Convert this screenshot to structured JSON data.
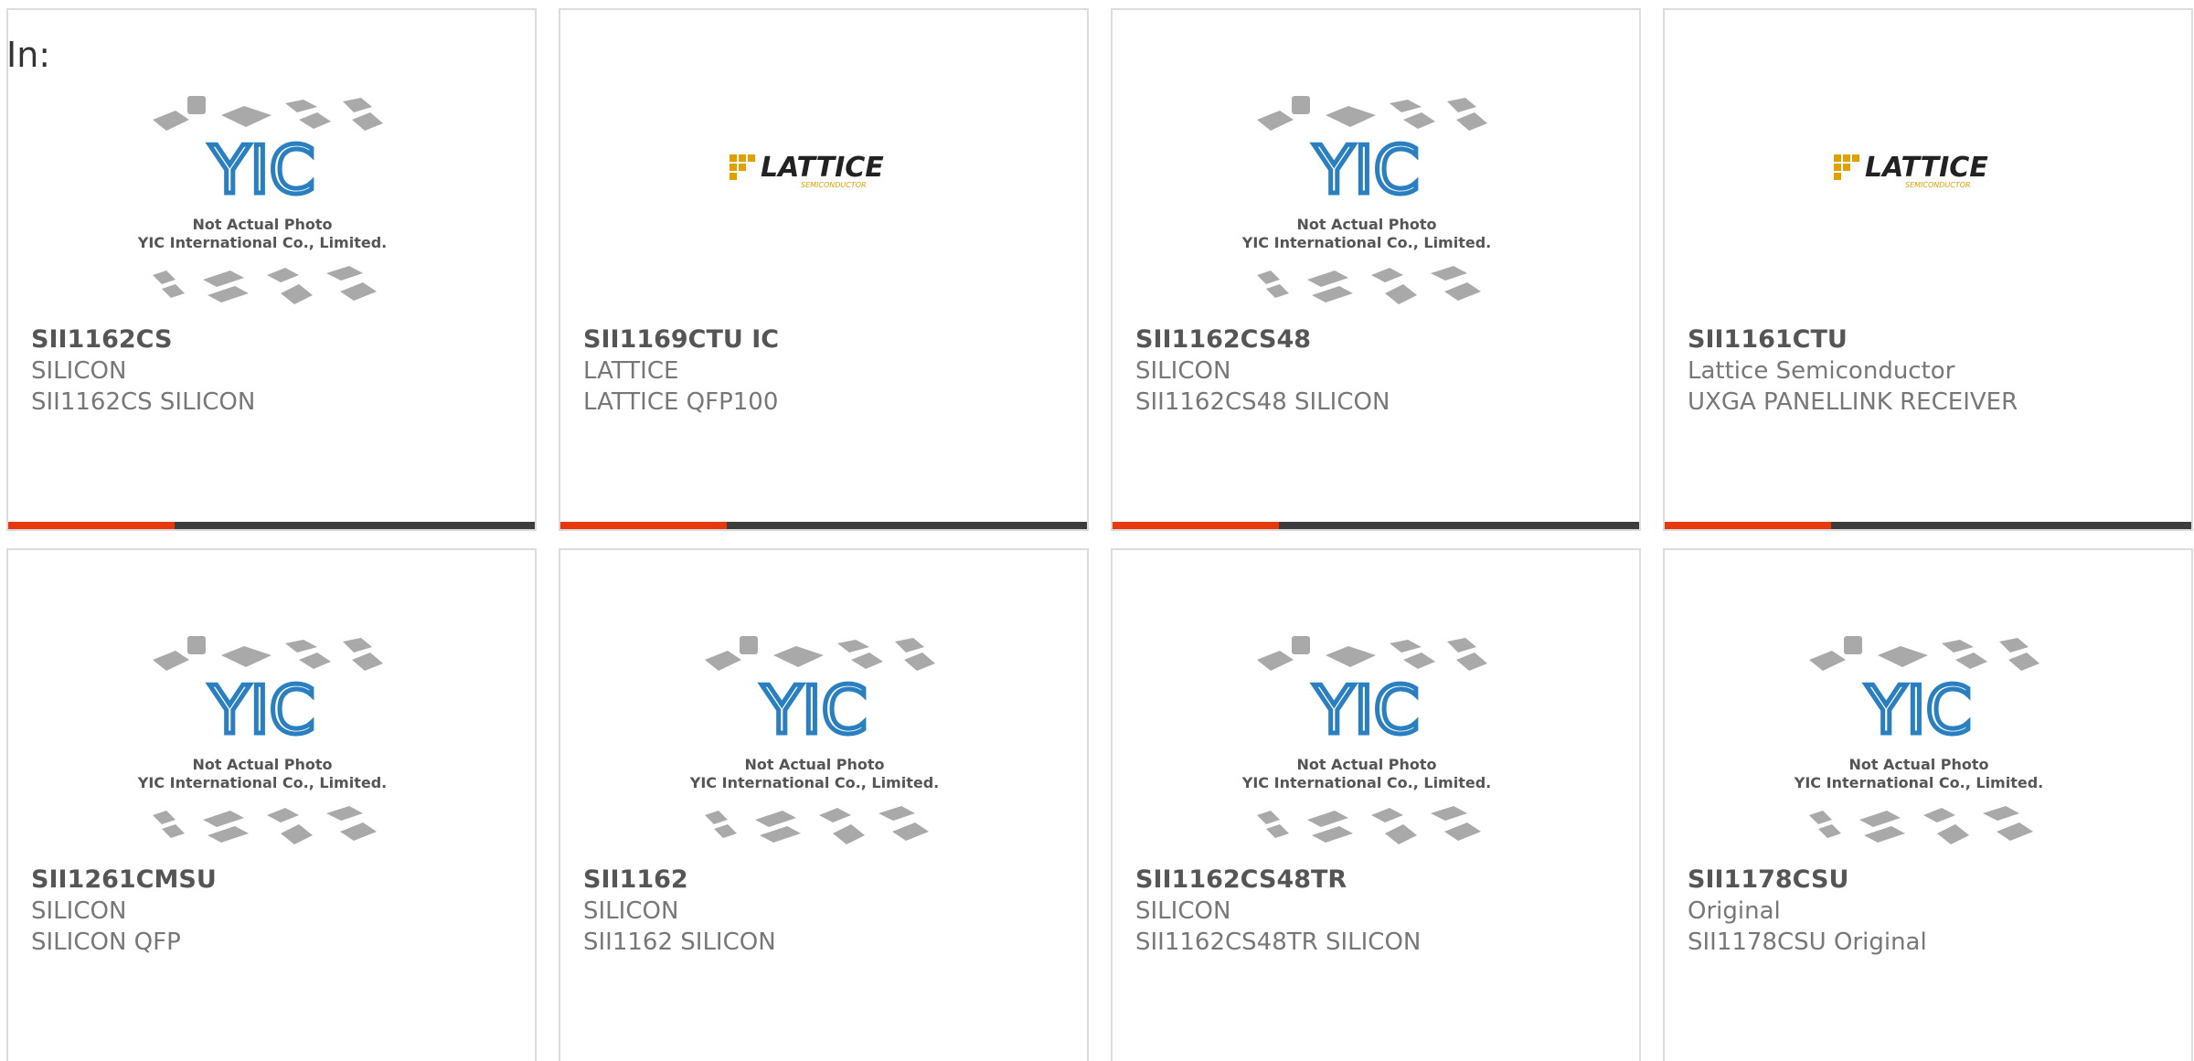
{
  "header": {
    "label": "In:"
  },
  "placeholder": {
    "line1": "Not Actual Photo",
    "line2": "YIC International Co., Limited."
  },
  "lattice_logo": {
    "word": "LATTICE",
    "sub": "SEMICONDUCTOR"
  },
  "colors": {
    "accent": "#e8380d",
    "bar": "#3d3d3d",
    "yic_blue": "#2a7fc1",
    "lattice_gold": "#f2a900"
  },
  "products": [
    {
      "part": "SII1162CS",
      "manufacturer": "SILICON",
      "description": "SII1162CS SILICON",
      "image": "yic-placeholder"
    },
    {
      "part": "SII1169CTU IC",
      "manufacturer": "LATTICE",
      "description": "LATTICE QFP100",
      "image": "lattice-logo"
    },
    {
      "part": "SII1162CS48",
      "manufacturer": "SILICON",
      "description": "SII1162CS48 SILICON",
      "image": "yic-placeholder"
    },
    {
      "part": "SII1161CTU",
      "manufacturer": "Lattice Semiconductor",
      "description": "UXGA PANELLINK RECEIVER",
      "image": "lattice-logo"
    },
    {
      "part": "SII1261CMSU",
      "manufacturer": "SILICON",
      "description": "SILICON QFP",
      "image": "yic-placeholder"
    },
    {
      "part": "SII1162",
      "manufacturer": "SILICON",
      "description": "SII1162 SILICON",
      "image": "yic-placeholder"
    },
    {
      "part": "SII1162CS48TR",
      "manufacturer": "SILICON",
      "description": "SII1162CS48TR SILICON",
      "image": "yic-placeholder"
    },
    {
      "part": "SII1178CSU",
      "manufacturer": "Original",
      "description": "SII1178CSU Original",
      "image": "yic-placeholder"
    }
  ]
}
